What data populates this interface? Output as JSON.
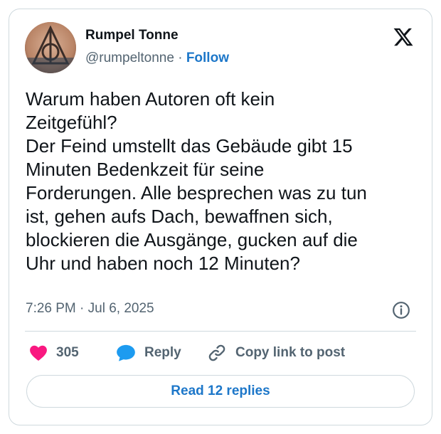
{
  "author": {
    "display_name": "Rumpel Tonne",
    "handle": "@rumpeltonne",
    "separator": "·",
    "follow_label": "Follow"
  },
  "tweet": {
    "text": "Warum haben Autoren oft kein\nZeitgefühl?\nDer Feind umstellt das Gebäude gibt 15\nMinuten Bedenkzeit für seine\nForderungen. Alle besprechen was zu tun\nist, gehen aufs Dach, bewaffnen sich,\nblockieren die Ausgänge, gucken auf die\nUhr und haben noch 12 Minuten?",
    "timestamp": "7:26 PM · Jul 6, 2025"
  },
  "actions": {
    "like_count": "305",
    "reply_label": "Reply",
    "copy_link_label": "Copy link to post"
  },
  "read_replies_label": "Read 12 replies",
  "icons": {
    "brand": "x-logo-icon",
    "like": "heart-icon",
    "reply": "speech-bubble-icon",
    "copy": "link-icon",
    "info": "info-icon"
  },
  "colors": {
    "accent": "#1d77c9",
    "like": "#f91880",
    "reply_icon": "#1d9bf0",
    "secondary_text": "#536471",
    "border": "#cfd9de"
  }
}
